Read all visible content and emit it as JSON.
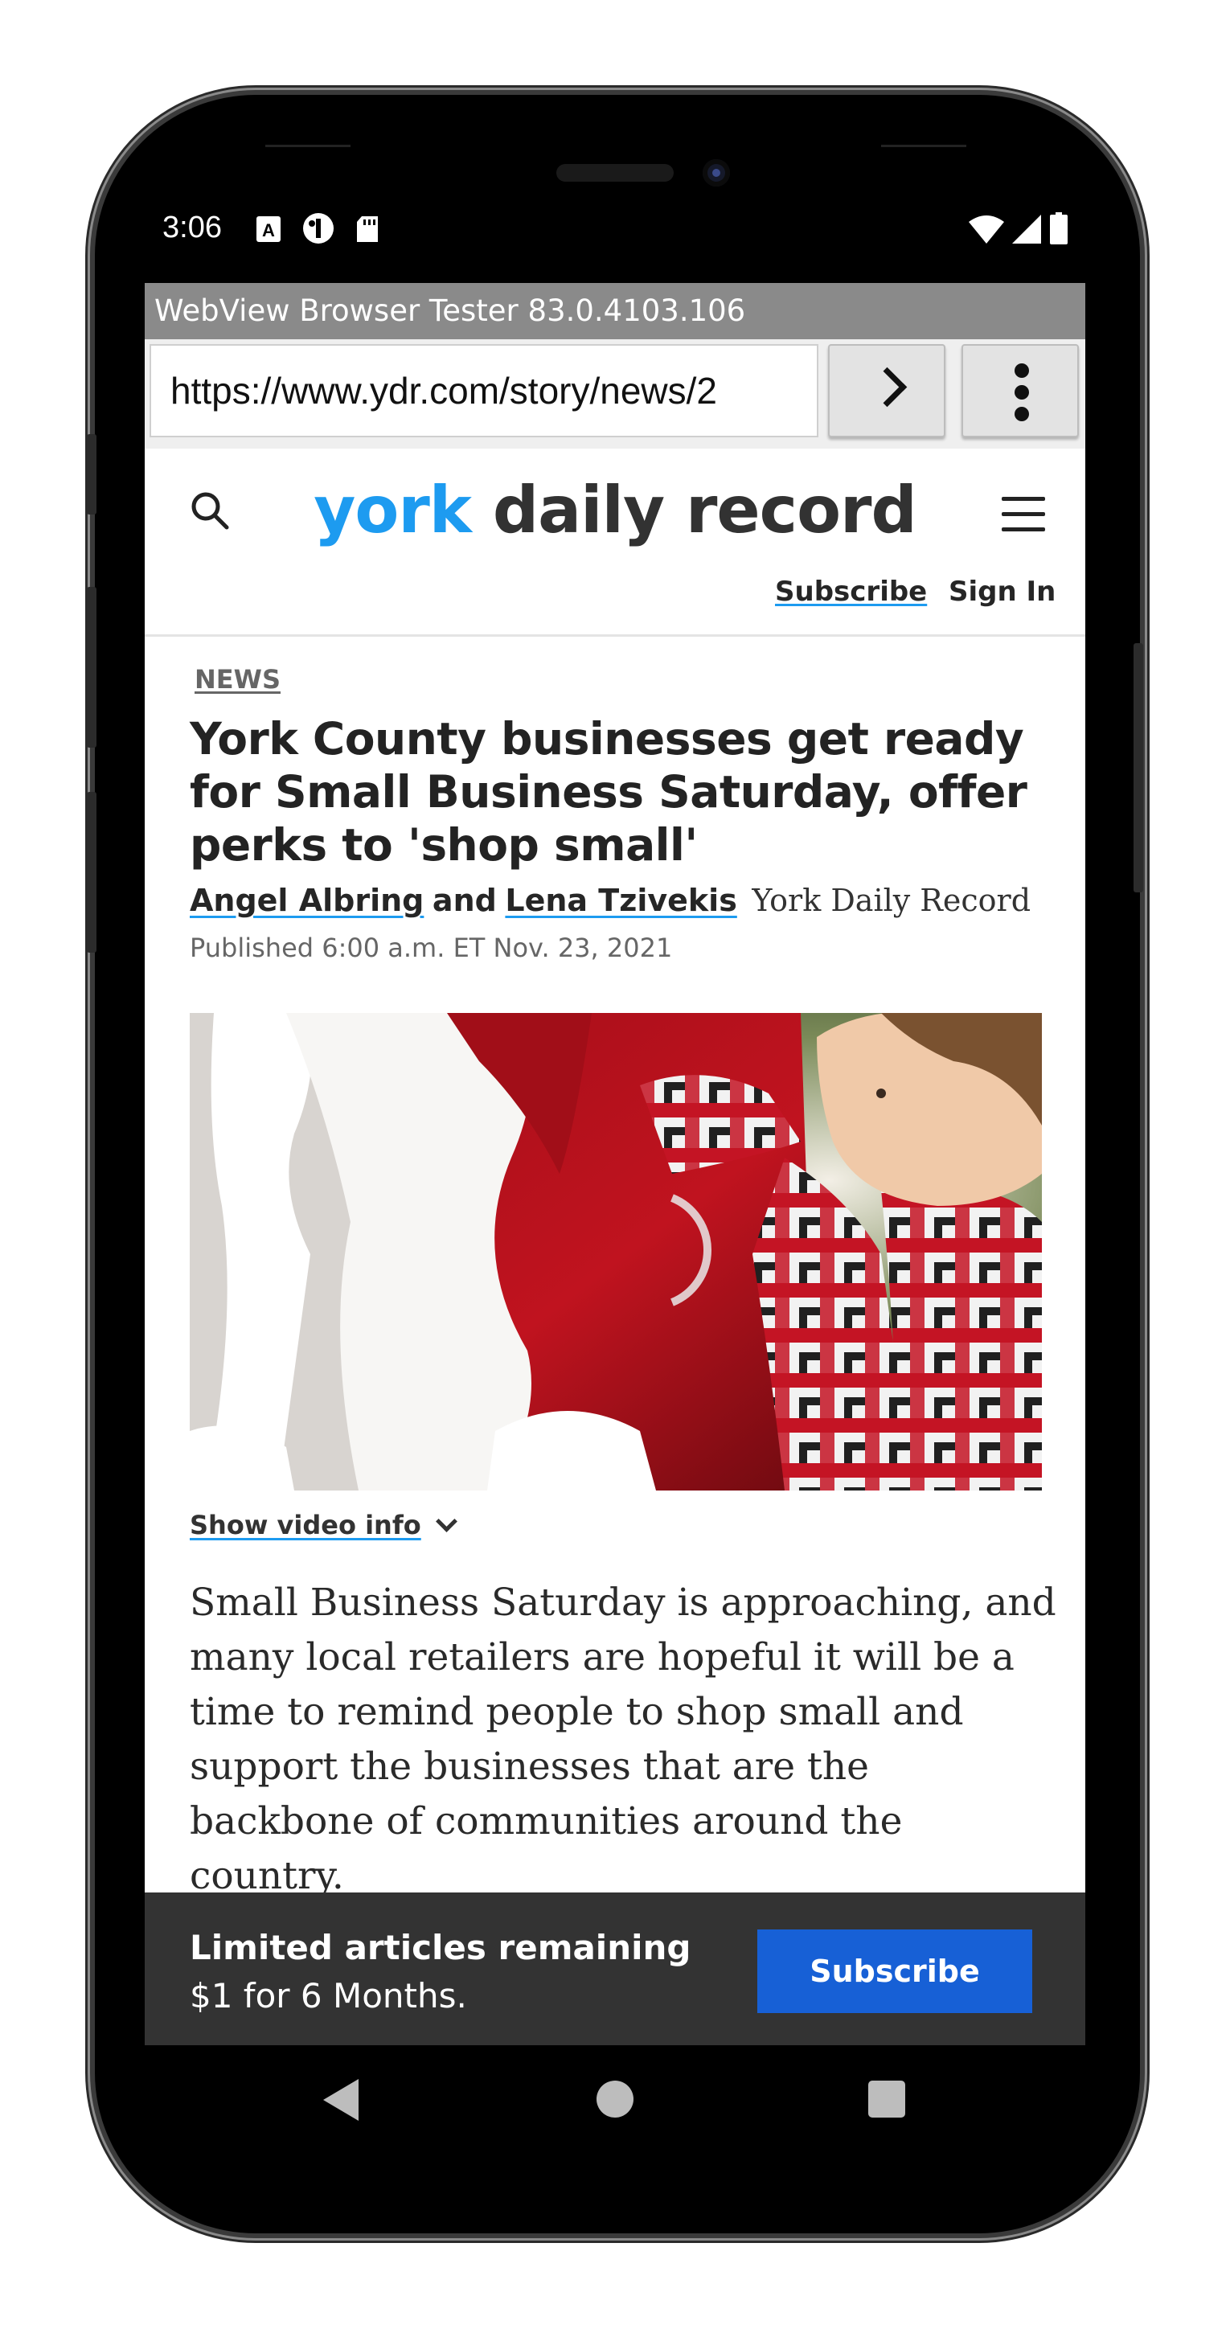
{
  "status_bar": {
    "time": "3:06",
    "left_icons": [
      "font-a-icon",
      "circle-app-icon",
      "sd-card-icon"
    ],
    "right_icons": [
      "wifi-icon",
      "signal-icon",
      "battery-icon"
    ]
  },
  "browser": {
    "title": "WebView Browser Tester 83.0.4103.106",
    "url": "https://www.ydr.com/story/news/2",
    "go_icon": "chevron-right-icon",
    "menu_icon": "more-vertical-icon"
  },
  "site": {
    "logo_york": "york",
    "logo_rest": " daily record",
    "subscribe_link": "Subscribe",
    "signin_link": "Sign In",
    "colors": {
      "brand_blue": "#1d9bf0",
      "subscribe_button": "#1760d6",
      "paywall_bg": "#333333"
    }
  },
  "article": {
    "section": "NEWS",
    "headline": "York County businesses get ready for Small Business Saturday, offer perks to 'shop small'",
    "author1": "Angel Albring",
    "and_text": "and",
    "author2": "Lena Tzivekis",
    "publication": "York Daily Record",
    "published": "Published 6:00 a.m. ET Nov. 23, 2021",
    "video_info_label": "Show video info",
    "body": "Small Business Saturday is approaching, and many local retailers are hopeful it will be a time to remind people to shop small and support the businesses that are the backbone of communities around the country."
  },
  "paywall": {
    "title": "Limited articles remaining",
    "offer": "$1 for 6 Months.",
    "button": "Subscribe"
  },
  "nav_bar": {
    "back_icon": "back-triangle-icon",
    "home_icon": "home-circle-icon",
    "recents_icon": "recents-square-icon"
  }
}
